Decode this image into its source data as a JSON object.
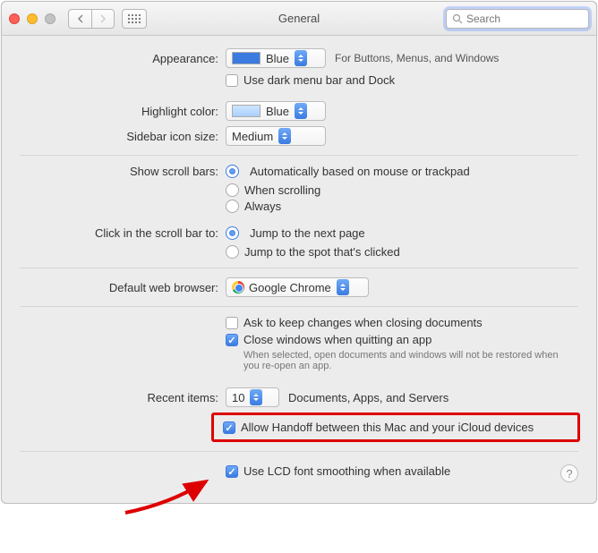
{
  "window": {
    "title": "General"
  },
  "search": {
    "placeholder": "Search"
  },
  "labels": {
    "appearance": "Appearance:",
    "highlight": "Highlight color:",
    "sidebar": "Sidebar icon size:",
    "scrollbars": "Show scroll bars:",
    "clickbar": "Click in the scroll bar to:",
    "browser": "Default web browser:",
    "recent": "Recent items:"
  },
  "appearance": {
    "value": "Blue",
    "side_text": "For Buttons, Menus, and Windows",
    "dark_label": "Use dark menu bar and Dock"
  },
  "highlight": {
    "value": "Blue"
  },
  "sidebar": {
    "value": "Medium"
  },
  "scroll": {
    "opt1": "Automatically based on mouse or trackpad",
    "opt2": "When scrolling",
    "opt3": "Always"
  },
  "clickbar": {
    "opt1": "Jump to the next page",
    "opt2": "Jump to the spot that's clicked"
  },
  "browser": {
    "value": "Google Chrome"
  },
  "docs": {
    "ask": "Ask to keep changes when closing documents",
    "close": "Close windows when quitting an app",
    "hint": "When selected, open documents and windows will not be restored when you re-open an app."
  },
  "recent": {
    "value": "10",
    "suffix": "Documents, Apps, and Servers"
  },
  "handoff": {
    "label": "Allow Handoff between this Mac and your iCloud devices"
  },
  "lcd": {
    "label": "Use LCD font smoothing when available"
  },
  "help": "?"
}
